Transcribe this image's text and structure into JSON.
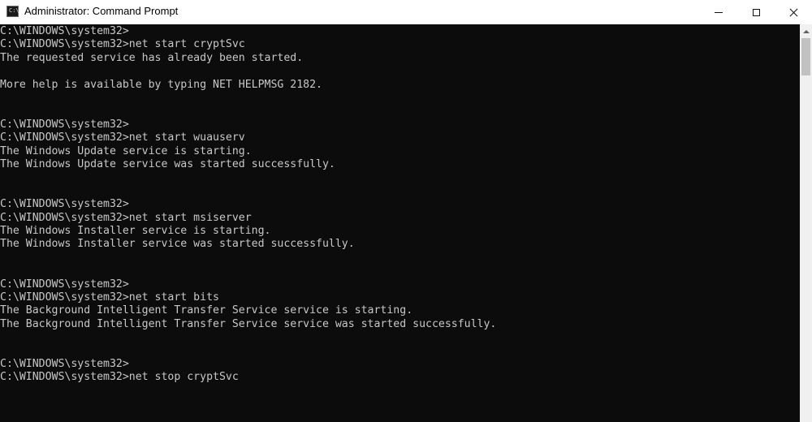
{
  "window": {
    "title": "Administrator: Command Prompt",
    "icon_text": "C:\\",
    "controls": {
      "minimize": "minimize-icon",
      "maximize": "maximize-icon",
      "close": "close-icon"
    }
  },
  "console": {
    "lines": [
      "C:\\WINDOWS\\system32>",
      "C:\\WINDOWS\\system32>net start cryptSvc",
      "The requested service has already been started.",
      "",
      "More help is available by typing NET HELPMSG 2182.",
      "",
      "",
      "C:\\WINDOWS\\system32>",
      "C:\\WINDOWS\\system32>net start wuauserv",
      "The Windows Update service is starting.",
      "The Windows Update service was started successfully.",
      "",
      "",
      "C:\\WINDOWS\\system32>",
      "C:\\WINDOWS\\system32>net start msiserver",
      "The Windows Installer service is starting.",
      "The Windows Installer service was started successfully.",
      "",
      "",
      "C:\\WINDOWS\\system32>",
      "C:\\WINDOWS\\system32>net start bits",
      "The Background Intelligent Transfer Service service is starting.",
      "The Background Intelligent Transfer Service service was started successfully.",
      "",
      "",
      "C:\\WINDOWS\\system32>",
      "C:\\WINDOWS\\system32>net stop cryptSvc"
    ]
  },
  "colors": {
    "console_background": "#0c0c0c",
    "console_text": "#c8c8c8",
    "titlebar_background": "#ffffff"
  }
}
